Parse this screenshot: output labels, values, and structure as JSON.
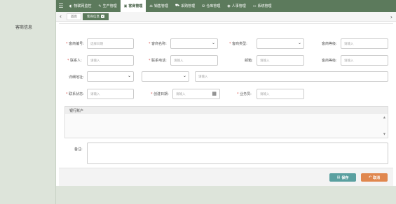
{
  "sidebar": {
    "items": [
      {
        "label": "客商信息"
      }
    ]
  },
  "topnav": {
    "items": [
      {
        "label": "物联网监控",
        "icon": "monitor-icon",
        "glyph": "◐"
      },
      {
        "label": "生产管理",
        "icon": "wrench-icon",
        "glyph": "✎"
      },
      {
        "label": "客商管理",
        "icon": "card-icon",
        "glyph": "▣",
        "active": true
      },
      {
        "label": "销售管理",
        "icon": "sales-icon",
        "glyph": "⚖"
      },
      {
        "label": "采购管理",
        "icon": "truck-icon",
        "glyph": "⛟"
      },
      {
        "label": "仓库管理",
        "icon": "warehouse-icon",
        "glyph": "⛁"
      },
      {
        "label": "人事管理",
        "icon": "eye-icon",
        "glyph": "◉"
      },
      {
        "label": "系统管理",
        "icon": "laptop-icon",
        "glyph": "▭"
      }
    ]
  },
  "tabs": [
    {
      "label": "首页"
    },
    {
      "label": "客商信息",
      "active": true
    }
  ],
  "form": {
    "code": {
      "label": "客商编号:",
      "placeholder": "选择日期"
    },
    "name": {
      "label": "客商名称:",
      "value": ""
    },
    "type": {
      "label": "客商类型:",
      "value": ""
    },
    "level": {
      "label": "客商等级:",
      "placeholder": "请输入"
    },
    "contact": {
      "label": "联系人:",
      "placeholder": "请输入"
    },
    "phone": {
      "label": "联系电话:",
      "placeholder": "请输入"
    },
    "email": {
      "label": "邮箱:",
      "placeholder": "请输入"
    },
    "grade": {
      "label": "客商等级:",
      "placeholder": "请输入"
    },
    "address": {
      "label": "详细地址:",
      "placeholder": "请输入"
    },
    "status": {
      "label": "联系状态:",
      "placeholder": "请输入"
    },
    "created": {
      "label": "创建日期:",
      "placeholder": "请输入"
    },
    "salesman": {
      "label": "业务员:",
      "placeholder": "请输入"
    },
    "bank": {
      "title": "银行账户"
    },
    "remark": {
      "label": "备注:"
    }
  },
  "buttons": {
    "save": "保存",
    "cancel": "取消"
  },
  "colors": {
    "accent": "#5c7a5c",
    "save": "#5aa0a0",
    "cancel": "#e0874e",
    "required": "#d9534f"
  }
}
